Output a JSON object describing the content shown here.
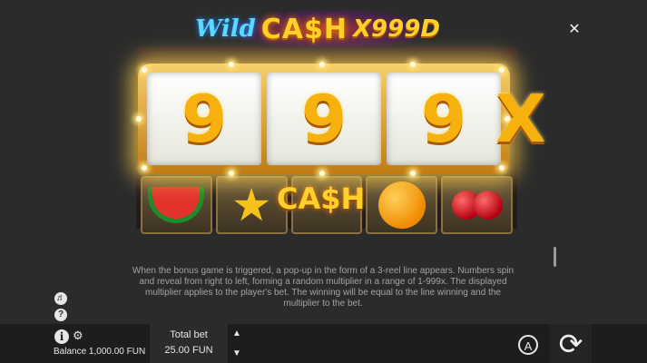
{
  "logo": {
    "wild": "Wild",
    "cash": "CA$H",
    "multiplier": "X999D"
  },
  "close_glyph": "✕",
  "bonus": {
    "digits": [
      "9",
      "9",
      "9"
    ],
    "x_mark": "X",
    "symbols": [
      "watermelon",
      "star",
      "orange",
      "cherries"
    ]
  },
  "description": "When the bonus game is triggered, a pop-up in the form of a 3-reel line appears. Numbers spin and reveal from right to left, forming a random multiplier in a range of 1-999x. The displayed multiplier applies to the player's bet. The winning will be equal to the line winning and the multiplier to the bet.",
  "side_icons": {
    "sound": "♬",
    "help": "?"
  },
  "bottom_bar": {
    "info_glyph": "i",
    "settings_glyph": "⚙",
    "balance": "Balance 1,000.00 FUN",
    "total_bet_label": "Total bet",
    "total_bet_value": "25.00 FUN",
    "bet_up": "▲",
    "bet_down": "▼",
    "auto_label": "A",
    "spin_glyph": "⟳"
  },
  "colors": {
    "gold": "#f7b10f",
    "background": "#2b2b2b",
    "bar": "#1d1d1d"
  }
}
